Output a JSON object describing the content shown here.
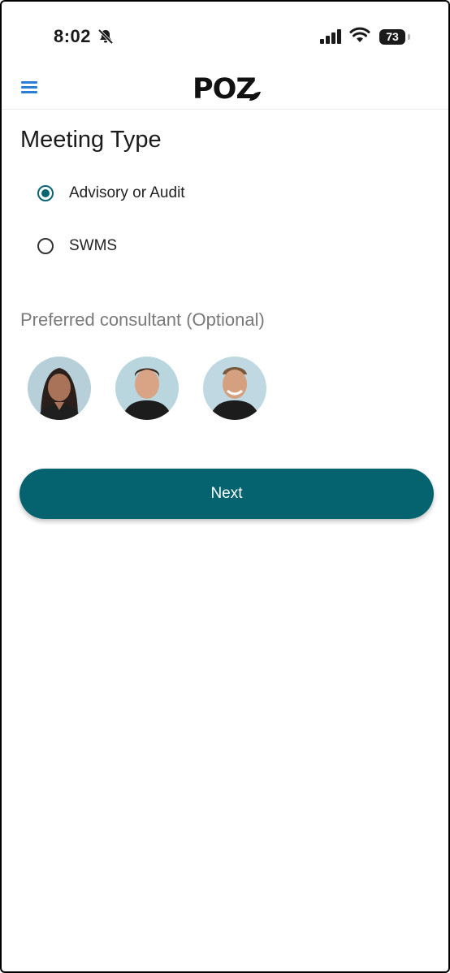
{
  "status_bar": {
    "time": "8:02",
    "battery": "73",
    "icons": [
      "bell-slash-icon",
      "cellular-signal-icon",
      "wifi-icon",
      "battery-icon"
    ]
  },
  "header": {
    "logo": "POZ",
    "menu_icon": "hamburger-menu-icon",
    "accent_color": "#2a7fd4"
  },
  "meeting_type": {
    "title": "Meeting Type",
    "options": [
      {
        "label": "Advisory or Audit",
        "selected": true
      },
      {
        "label": "SWMS",
        "selected": false
      }
    ]
  },
  "consultant": {
    "heading": "Preferred consultant (Optional)",
    "avatars": [
      "consultant-avatar-1",
      "consultant-avatar-2",
      "consultant-avatar-3"
    ]
  },
  "actions": {
    "next_label": "Next",
    "button_color": "#04636f"
  }
}
